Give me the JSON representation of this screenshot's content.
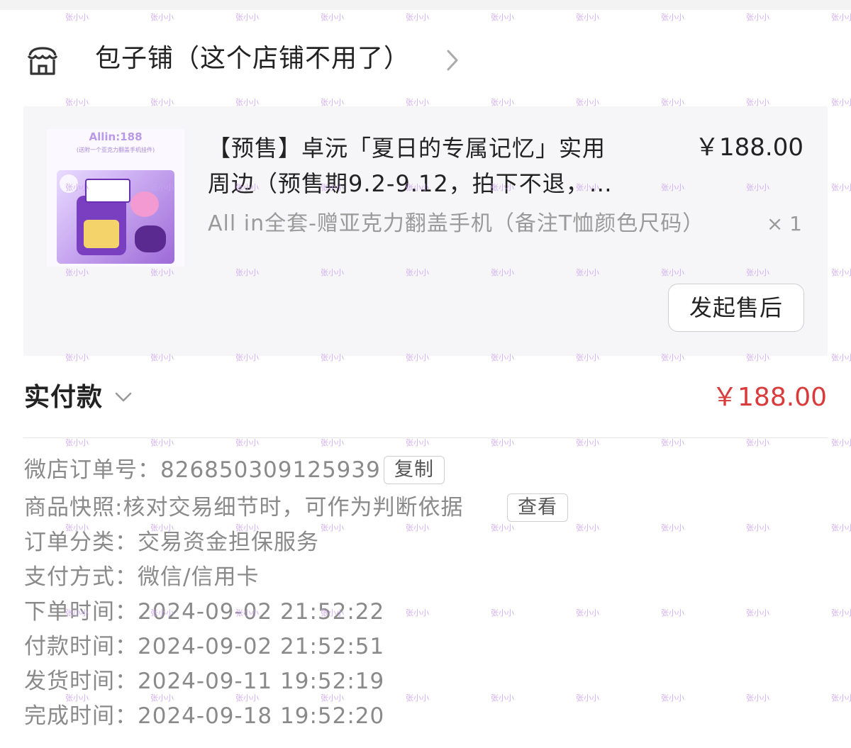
{
  "shop": {
    "name": "包子铺（这个店铺不用了）",
    "icon": "storefront-icon"
  },
  "product": {
    "thumbnail": {
      "brand_text": "Allin:188",
      "sub_text": "(送附一个亚克力翻盖手机挂件)"
    },
    "title_line1": "【预售】卓沅「夏日的专属记忆」实用",
    "title_line2": "周边（预售期9.2-9.12，拍下不退，…",
    "price": "￥188.00",
    "sku": "All in全套-赠亚克力翻盖手机（备注T恤颜色尺码）",
    "quantity": "× 1",
    "aftersale_label": "发起售后"
  },
  "payment": {
    "label": "实付款",
    "amount": "￥188.00",
    "amount_color": "#d93a3a"
  },
  "details": {
    "order_no_label": "微店订单号：",
    "order_no": "826850309125939",
    "copy_label": "复制",
    "snapshot_label": "商品快照:",
    "snapshot_value": "核对交易细节时，可作为判断依据",
    "view_label": "查看",
    "category_label": "订单分类：",
    "category_value": "交易资金担保服务",
    "payment_method_label": "支付方式：",
    "payment_method_value": "微信/信用卡",
    "order_time_label": "下单时间：",
    "order_time_value": "2024-09-02 21:52:22",
    "pay_time_label": "付款时间：",
    "pay_time_value": "2024-09-02 21:52:51",
    "ship_time_label": "发货时间：",
    "ship_time_value": "2024-09-11 19:52:19",
    "complete_time_label": "完成时间：",
    "complete_time_value": "2024-09-18 19:52:20"
  },
  "watermark": {
    "text": "张小小",
    "color": "#c9a3f0"
  }
}
